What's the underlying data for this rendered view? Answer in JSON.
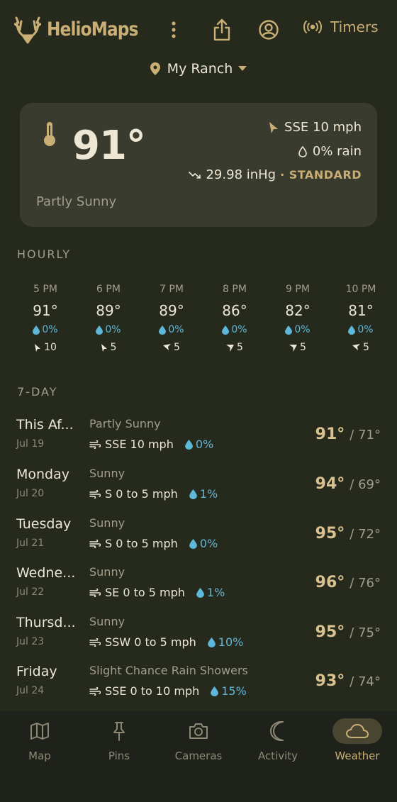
{
  "header": {
    "brand": "HelioMaps",
    "timers_label": "Timers"
  },
  "location": {
    "name": "My Ranch"
  },
  "current": {
    "temp": "91°",
    "condition": "Partly Sunny",
    "wind": "SSE 10 mph",
    "rain": "0% rain",
    "pressure": "29.98 inHg",
    "pressure_status": "· STANDARD"
  },
  "hourly": {
    "title": "HOURLY",
    "items": [
      {
        "time": "5 PM",
        "temp": "91°",
        "rain": "0%",
        "wind": "10"
      },
      {
        "time": "6 PM",
        "temp": "89°",
        "rain": "0%",
        "wind": "5"
      },
      {
        "time": "7 PM",
        "temp": "89°",
        "rain": "0%",
        "wind": "5"
      },
      {
        "time": "8 PM",
        "temp": "86°",
        "rain": "0%",
        "wind": "5"
      },
      {
        "time": "9 PM",
        "temp": "82°",
        "rain": "0%",
        "wind": "5"
      },
      {
        "time": "10 PM",
        "temp": "81°",
        "rain": "0%",
        "wind": "5"
      }
    ]
  },
  "daily": {
    "title": "7-DAY",
    "items": [
      {
        "name": "This Af...",
        "date": "Jul 19",
        "condition": "Partly Sunny",
        "wind": "SSE 10 mph",
        "rain": "0%",
        "hi": "91°",
        "lo": "/ 71°"
      },
      {
        "name": "Monday",
        "date": "Jul 20",
        "condition": "Sunny",
        "wind": "S 0 to 5 mph",
        "rain": "1%",
        "hi": "94°",
        "lo": "/ 69°"
      },
      {
        "name": "Tuesday",
        "date": "Jul 21",
        "condition": "Sunny",
        "wind": "S 0 to 5 mph",
        "rain": "0%",
        "hi": "95°",
        "lo": "/ 72°"
      },
      {
        "name": "Wedne...",
        "date": "Jul 22",
        "condition": "Sunny",
        "wind": "SE 0 to 5 mph",
        "rain": "1%",
        "hi": "96°",
        "lo": "/ 76°"
      },
      {
        "name": "Thursd...",
        "date": "Jul 23",
        "condition": "Sunny",
        "wind": "SSW 0 to 5 mph",
        "rain": "10%",
        "hi": "95°",
        "lo": "/ 75°"
      },
      {
        "name": "Friday",
        "date": "Jul 24",
        "condition": "Slight Chance Rain Showers",
        "wind": "SSE 0 to 10 mph",
        "rain": "15%",
        "hi": "93°",
        "lo": "/ 74°"
      }
    ]
  },
  "tabs": [
    {
      "label": "Map",
      "icon": "map-icon"
    },
    {
      "label": "Pins",
      "icon": "pin-icon"
    },
    {
      "label": "Cameras",
      "icon": "camera-icon"
    },
    {
      "label": "Activity",
      "icon": "moon-icon"
    },
    {
      "label": "Weather",
      "icon": "cloud-icon",
      "active": true
    }
  ],
  "colors": {
    "background": "#262A1D",
    "card": "#383B2E",
    "accent": "#C9AE75",
    "rain": "#5EB6D9",
    "tabbar": "#1F221A"
  }
}
